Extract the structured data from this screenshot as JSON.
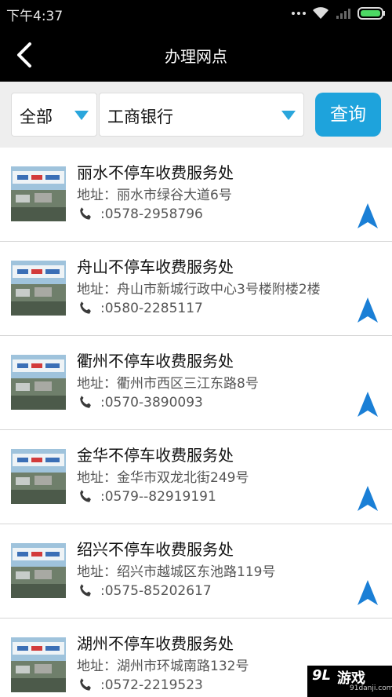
{
  "status_bar": {
    "time": "下午4:37",
    "icons": [
      "more-dots-icon",
      "wifi-icon",
      "signal-icon",
      "battery-icon"
    ]
  },
  "header": {
    "title": "办理网点",
    "back_icon": "back-arrow-icon"
  },
  "filters": {
    "category": "全部",
    "bank": "工商银行",
    "query_label": "查询",
    "accent_color": "#1ea3dc"
  },
  "outlets": [
    {
      "name": "丽水不停车收费服务处",
      "address": "地址：丽水市绿谷大道6号",
      "phone": ":0578-2958796"
    },
    {
      "name": "舟山不停车收费服务处",
      "address": "地址：舟山市新城行政中心3号楼附楼2楼",
      "phone": ":0580-2285117"
    },
    {
      "name": "衢州不停车收费服务处",
      "address": "地址：衢州市西区三江东路8号",
      "phone": ":0570-3890093"
    },
    {
      "name": "金华不停车收费服务处",
      "address": "地址：金华市双龙北街249号",
      "phone": ":0579--82919191"
    },
    {
      "name": "绍兴不停车收费服务处",
      "address": "地址：绍兴市越城区东池路119号",
      "phone": ":0575-85202617"
    },
    {
      "name": "湖州不停车收费服务处",
      "address": "地址：湖州市环城南路132号",
      "phone": ":0572-2219523"
    }
  ],
  "watermark": {
    "logo": "9L",
    "text": "游戏",
    "url": "91danji.com"
  }
}
